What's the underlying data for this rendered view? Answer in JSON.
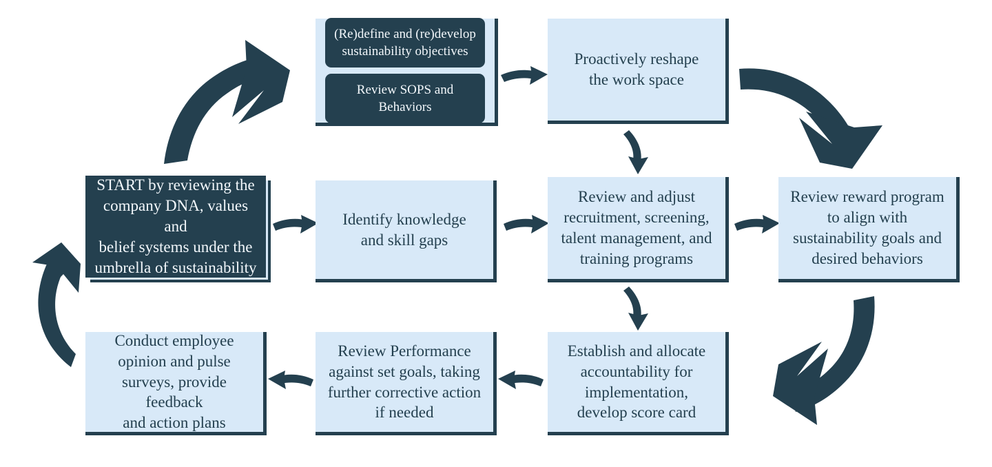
{
  "diagram": {
    "title": "Sustainability people-and-culture continuous improvement cycle",
    "colors": {
      "node_fill": "#d8e9f8",
      "node_accent": "#24404f",
      "node_text_dark": "#24404f",
      "node_text_light": "#f2f7fb",
      "background": "#ffffff"
    },
    "nodes": [
      {
        "id": "start",
        "style": "dark",
        "label": "START by reviewing the\ncompany DNA, values and\nbelief systems under the\numbrella of sustainability"
      },
      {
        "id": "objectives",
        "style": "composite",
        "items": [
          "(Re)define and (re)develop\nsustainability objectives",
          "Review SOPS and\nBehaviors"
        ]
      },
      {
        "id": "workspace",
        "style": "light",
        "label": "Proactively reshape\nthe work space"
      },
      {
        "id": "reward",
        "style": "light",
        "label": "Review reward program\nto align with\nsustainability goals and\ndesired behaviors"
      },
      {
        "id": "knowledge",
        "style": "light",
        "label": "Identify knowledge\nand skill gaps"
      },
      {
        "id": "recruitment",
        "style": "light",
        "label": "Review and adjust\nrecruitment, screening,\ntalent management, and\ntraining programs"
      },
      {
        "id": "accountability",
        "style": "light",
        "label": "Establish and allocate\naccountability for\nimplementation,\ndevelop score card"
      },
      {
        "id": "performance",
        "style": "light",
        "label": "Review Performance\nagainst set goals, taking\nfurther corrective action\nif needed"
      },
      {
        "id": "surveys",
        "style": "light",
        "label": "Conduct employee\nopinion and pulse\nsurveys, provide feedback\nand action plans"
      }
    ],
    "connectors": [
      {
        "id": "start-to-objectives",
        "icon": "curved-arrow-up-right-large"
      },
      {
        "id": "objectives-to-workspace",
        "icon": "curved-arrow-right-small"
      },
      {
        "id": "workspace-to-reward",
        "icon": "curved-arrow-down-right-large"
      },
      {
        "id": "workspace-to-recruitment",
        "icon": "curved-arrow-down-small"
      },
      {
        "id": "start-to-knowledge",
        "icon": "curved-arrow-right-small"
      },
      {
        "id": "knowledge-to-recruitment",
        "icon": "curved-arrow-right-small"
      },
      {
        "id": "recruitment-to-reward",
        "icon": "curved-arrow-right-small"
      },
      {
        "id": "recruitment-to-accountability",
        "icon": "curved-arrow-down-small"
      },
      {
        "id": "reward-to-accountability",
        "icon": "curved-arrow-down-left-large"
      },
      {
        "id": "accountability-to-performance",
        "icon": "curved-arrow-left-small"
      },
      {
        "id": "performance-to-surveys",
        "icon": "curved-arrow-left-small"
      },
      {
        "id": "surveys-to-start",
        "icon": "curved-arrow-up-left-large"
      }
    ]
  }
}
